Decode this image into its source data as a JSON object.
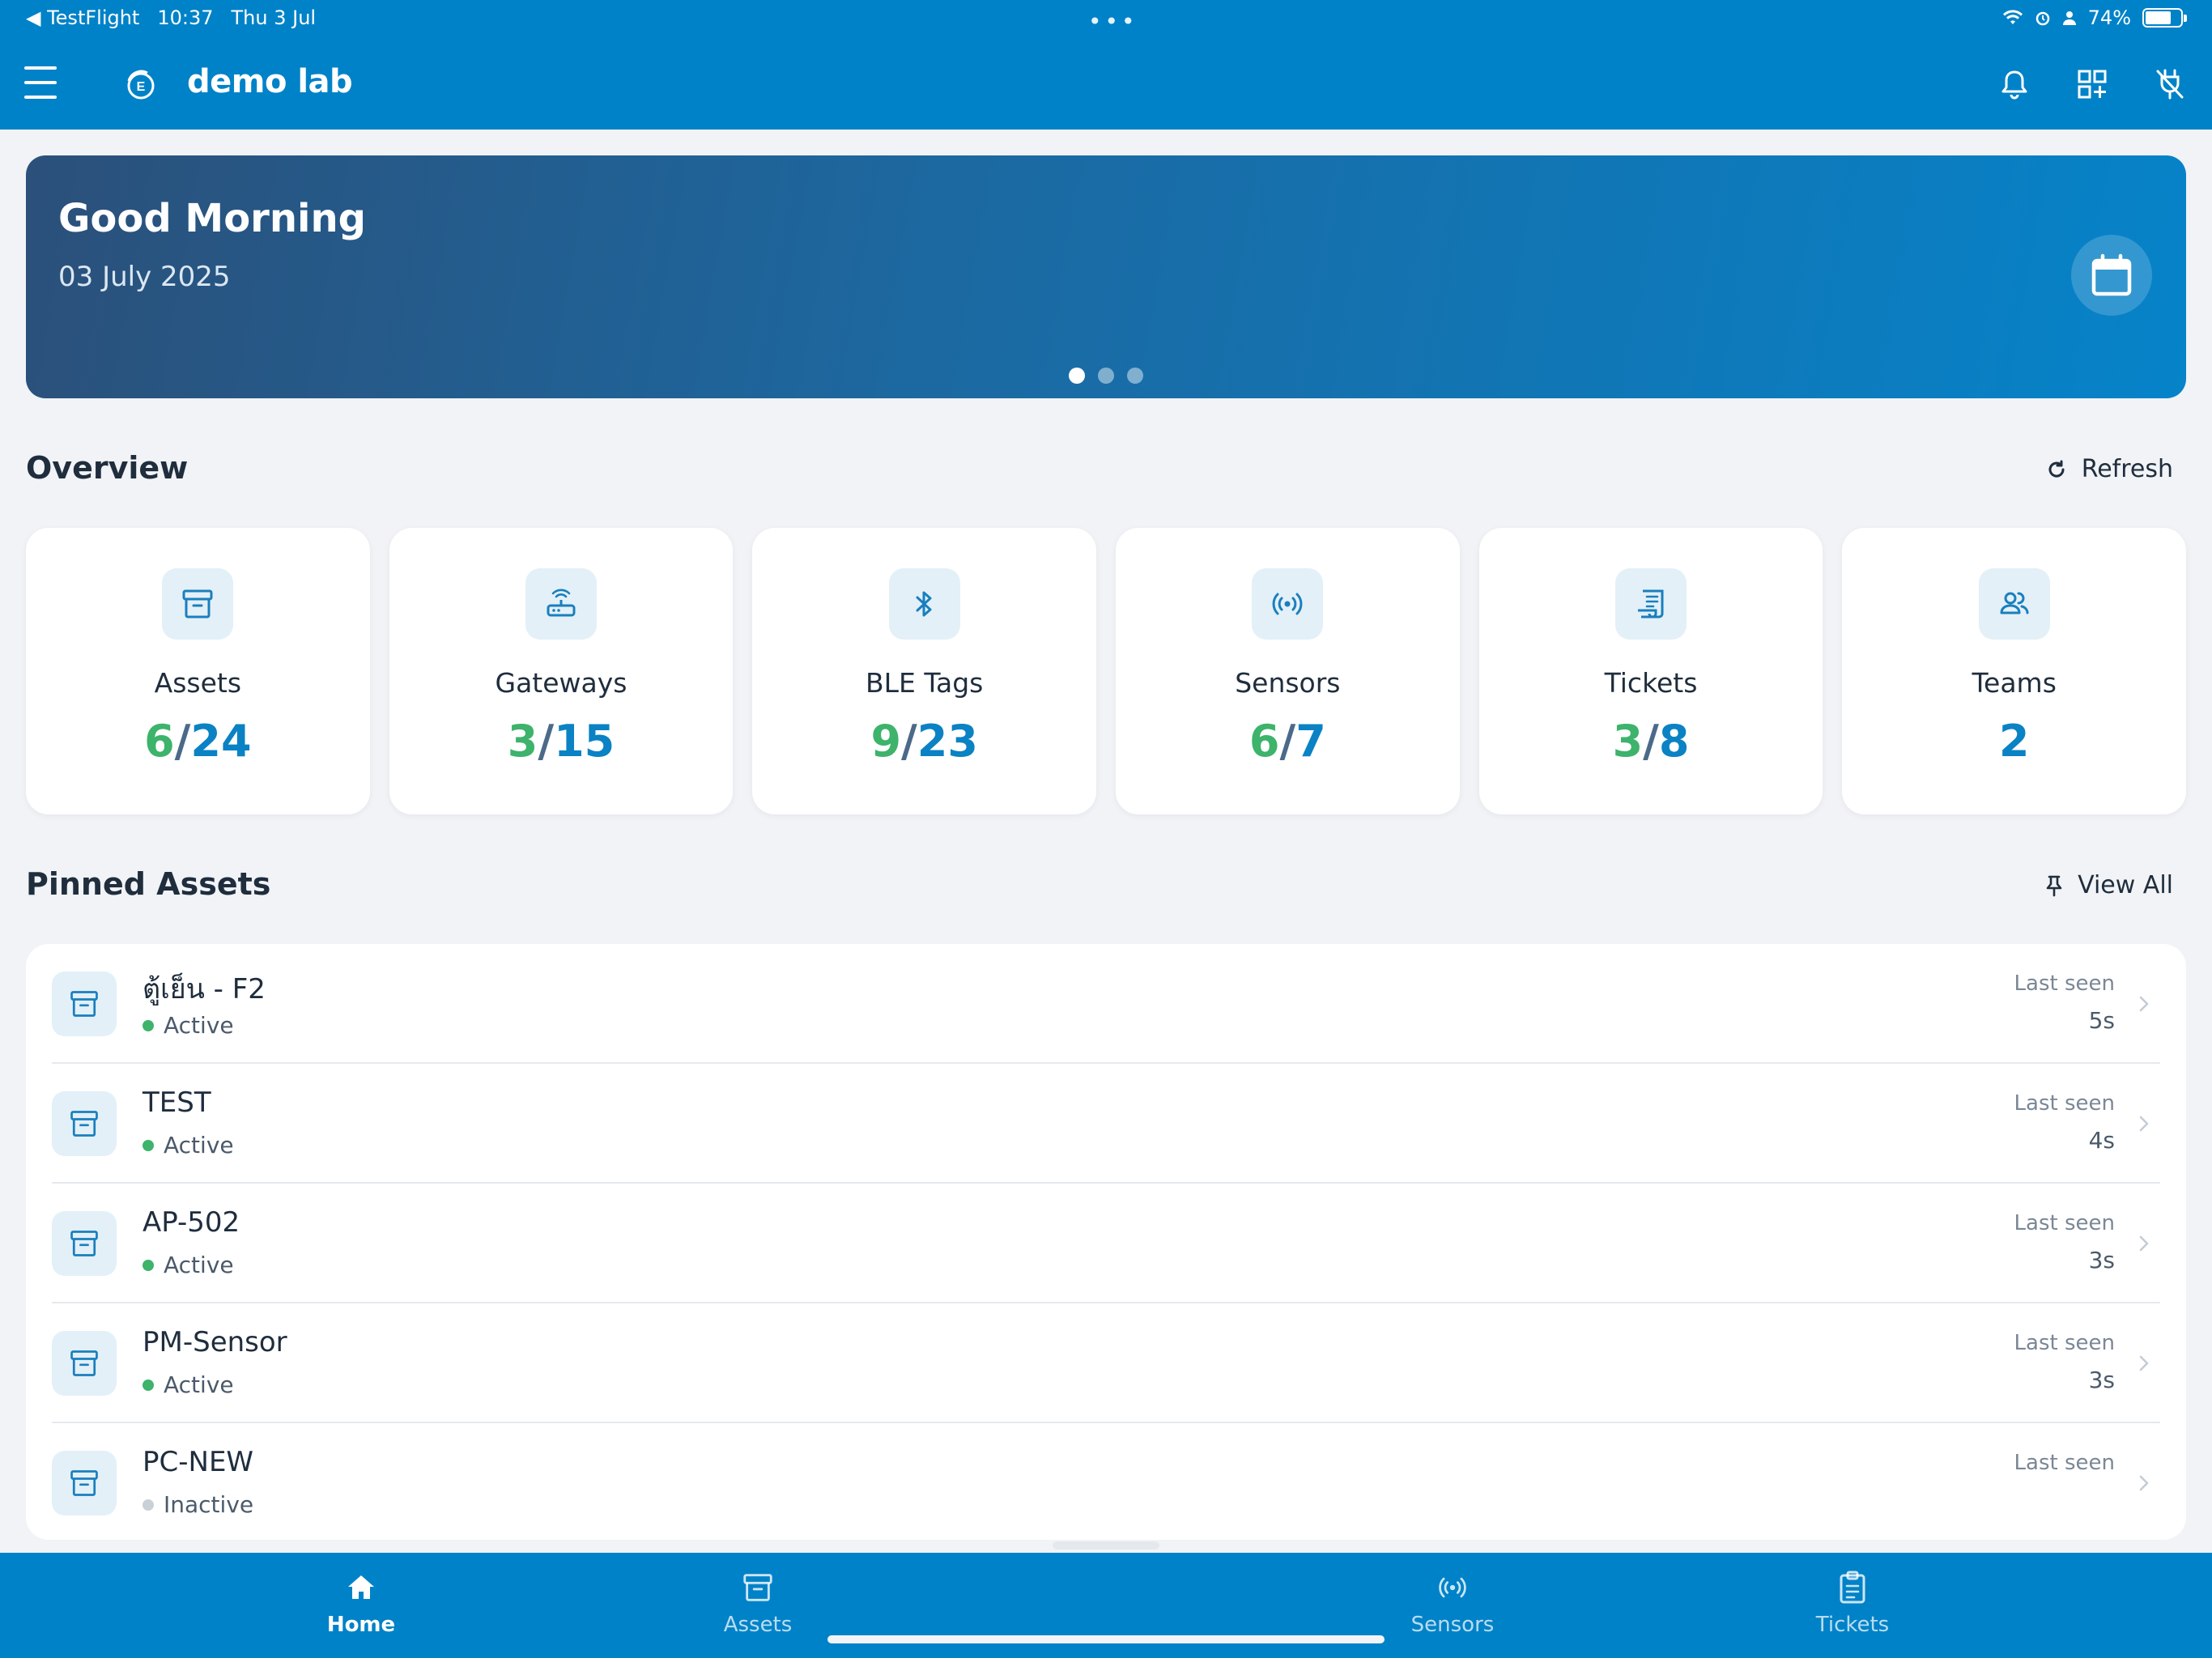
{
  "status_bar": {
    "back_app": "◀ TestFlight",
    "time": "10:37",
    "date": "Thu 3 Jul",
    "multitask_dots": "•••",
    "battery": "74%"
  },
  "app_bar": {
    "title": "demo lab"
  },
  "banner": {
    "greeting": "Good Morning",
    "date": "03 July 2025",
    "page_dots": 3,
    "active_dot": 1
  },
  "overview": {
    "title": "Overview",
    "refresh_label": "Refresh",
    "cards": [
      {
        "label": "Assets",
        "active": "6",
        "total": "24",
        "icon": "archive-icon"
      },
      {
        "label": "Gateways",
        "active": "3",
        "total": "15",
        "icon": "router-icon"
      },
      {
        "label": "BLE Tags",
        "active": "9",
        "total": "23",
        "icon": "bluetooth-icon"
      },
      {
        "label": "Sensors",
        "active": "6",
        "total": "7",
        "icon": "sensor-broadcast-icon"
      },
      {
        "label": "Tickets",
        "active": "3",
        "total": "8",
        "icon": "receipt-icon"
      },
      {
        "label": "Teams",
        "value": "2",
        "icon": "people-icon"
      }
    ]
  },
  "pinned": {
    "title": "Pinned Assets",
    "view_all_label": "View All",
    "last_seen_label": "Last seen",
    "rows": [
      {
        "name": "ตู้เย็น - F2",
        "status": "Active",
        "last_seen": "5s"
      },
      {
        "name": "TEST",
        "status": "Active",
        "last_seen": "4s"
      },
      {
        "name": "AP-502",
        "status": "Active",
        "last_seen": "3s"
      },
      {
        "name": "PM-Sensor",
        "status": "Active",
        "last_seen": "3s"
      },
      {
        "name": "PC-NEW",
        "status": "Inactive",
        "last_seen": ""
      }
    ]
  },
  "tabbar": {
    "tabs": [
      {
        "label": "Home",
        "active": true
      },
      {
        "label": "Assets",
        "active": false
      },
      {
        "label": "Sensors",
        "active": false
      },
      {
        "label": "Tickets",
        "active": false
      }
    ]
  },
  "colors": {
    "primary": "#0082c8",
    "accent_green": "#3db36b",
    "value_blue": "#0a82c4",
    "background": "#f1f3f6"
  }
}
